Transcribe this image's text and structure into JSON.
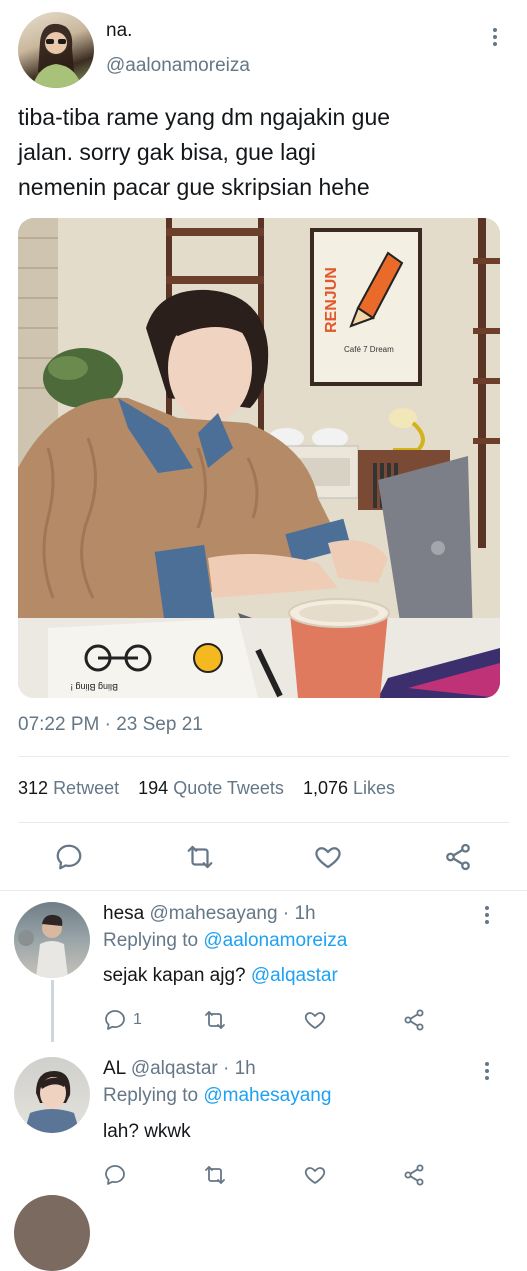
{
  "tweet": {
    "display_name": "na.",
    "handle": "@aalonamoreiza",
    "text_line1": "tiba-tiba rame yang dm ngajakin gue",
    "text_line2": "jalan. sorry gak bisa, gue lagi",
    "text_line3": "nemenin pacar gue skripsian hehe",
    "timestamp": "07:22 PM · 23 Sep 21",
    "stats": {
      "retweets_count": "312",
      "retweets_label": "Retweet",
      "quotes_count": "194",
      "quotes_label": "Quote Tweets",
      "likes_count": "1,076",
      "likes_label": "Likes"
    },
    "image_text": {
      "poster_word": "RENJUN",
      "poster_sub": "Café 7 Dream",
      "sticker_text": "Bling Bling !"
    }
  },
  "replies": [
    {
      "name": "hesa",
      "handle": "@mahesayang · 1h",
      "replying_label": "Replying to",
      "replying_to": "@aalonamoreiza",
      "text": "sejak kapan ajg?",
      "mention": "@alqastar",
      "reply_count": "1"
    },
    {
      "name": "AL",
      "handle": "@alqastar · 1h",
      "replying_label": "Replying to",
      "replying_to": "@mahesayang",
      "text": "lah? wkwk"
    }
  ],
  "icons": {
    "reply": "reply-icon",
    "retweet": "retweet-icon",
    "like": "like-icon",
    "share": "share-icon",
    "more": "more-icon"
  },
  "colors": {
    "link": "#1da1f2",
    "muted": "#657786",
    "divider": "#e6ecf0"
  }
}
